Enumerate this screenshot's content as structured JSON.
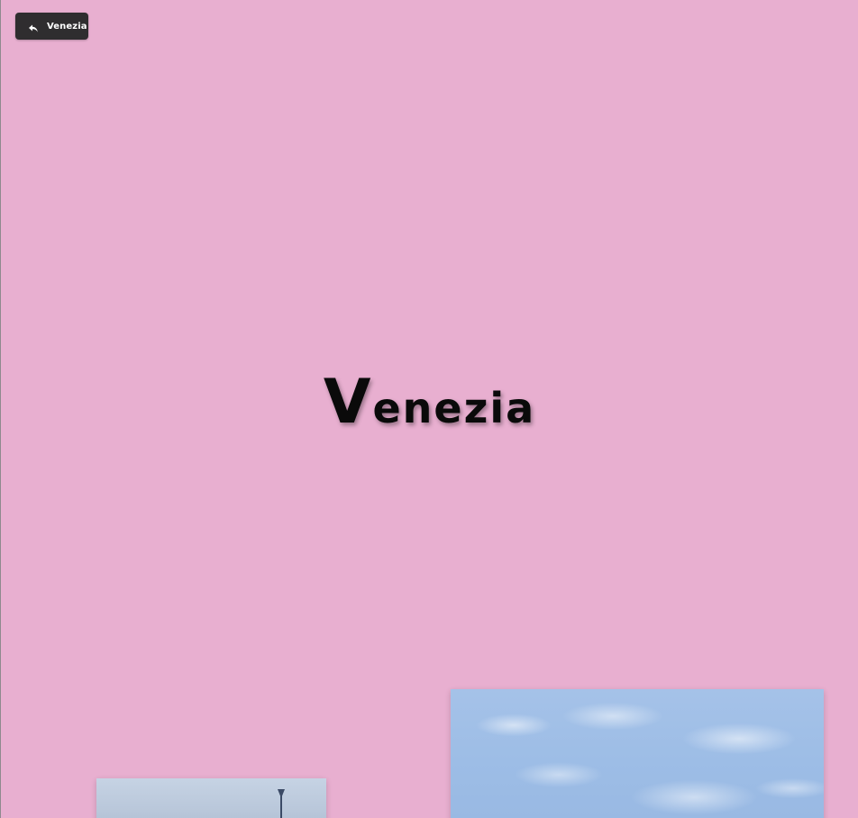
{
  "back_button": {
    "label": "Venezia",
    "icon": "reply-arrow-icon"
  },
  "hero": {
    "title_first_letter": "V",
    "title_rest": "enezia"
  },
  "colors": {
    "background": "#e8afd0",
    "button_background": "#2f2d2f",
    "title_color": "#0a0a0a"
  }
}
